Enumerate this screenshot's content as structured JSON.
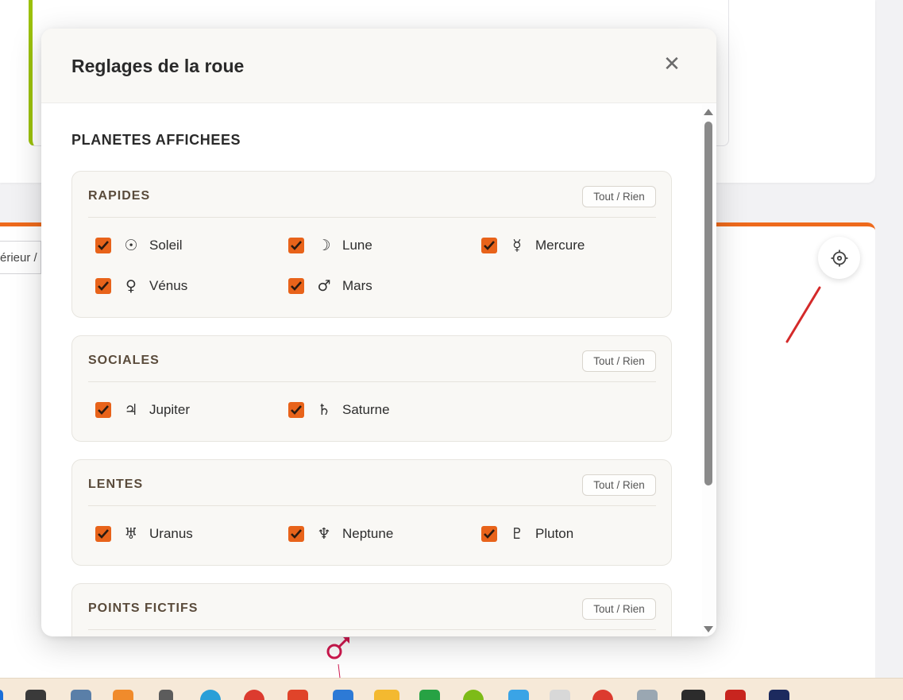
{
  "background": {
    "breadcrumb_fragment": "érieur /",
    "settings_icon": "gear-icon",
    "floating_symbol": "♂"
  },
  "modal": {
    "title": "Reglages de la roue",
    "close_label": "✕",
    "section_title": "PLANETES AFFICHEES",
    "toggle_label": "Tout / Rien",
    "groups": [
      {
        "title": "RAPIDES",
        "items": [
          {
            "glyph": "☉",
            "label": "Soleil",
            "checked": true
          },
          {
            "glyph": "☽",
            "label": "Lune",
            "checked": true
          },
          {
            "glyph": "☿",
            "label": "Mercure",
            "checked": true
          },
          {
            "glyph": "♀",
            "label": "Vénus",
            "checked": true
          },
          {
            "glyph": "♂",
            "label": "Mars",
            "checked": true
          }
        ]
      },
      {
        "title": "SOCIALES",
        "items": [
          {
            "glyph": "♃",
            "label": "Jupiter",
            "checked": true
          },
          {
            "glyph": "♄",
            "label": "Saturne",
            "checked": true
          }
        ]
      },
      {
        "title": "LENTES",
        "items": [
          {
            "glyph": "♅",
            "label": "Uranus",
            "checked": true
          },
          {
            "glyph": "♆",
            "label": "Neptune",
            "checked": true
          },
          {
            "glyph": "♇",
            "label": "Pluton",
            "checked": true
          }
        ]
      },
      {
        "title": "POINTS FICTIFS",
        "items": []
      }
    ]
  },
  "colors": {
    "accent_orange": "#e8631a",
    "top_card_border": "#9bc00a",
    "bottom_card_border": "#ee6a1c",
    "mars_symbol": "#d0184f",
    "annotation_red": "#d42a2a"
  }
}
